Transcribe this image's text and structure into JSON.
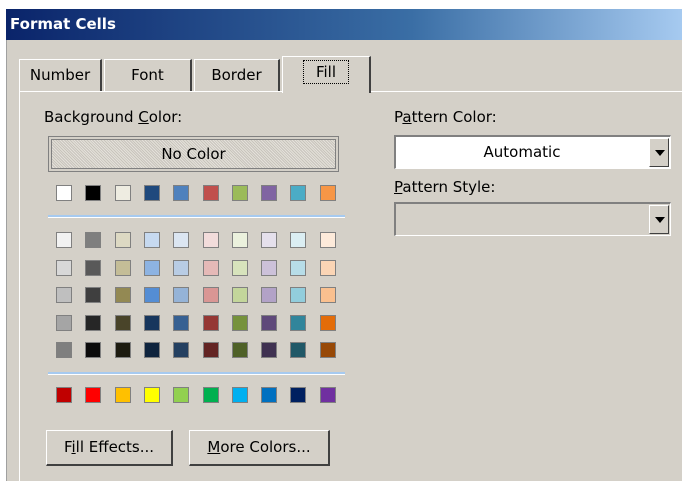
{
  "dialog": {
    "title": "Format Cells"
  },
  "tabs": [
    {
      "label": "Number",
      "active": false
    },
    {
      "label": "Font",
      "active": false
    },
    {
      "label": "Border",
      "active": false
    },
    {
      "label": "Fill",
      "active": true
    }
  ],
  "background": {
    "label_pre": "Background ",
    "label_u": "C",
    "label_post": "olor:",
    "no_color_label": "No Color"
  },
  "palette": {
    "row0": [
      "#ffffff",
      "#000000",
      "#eeece1",
      "#1f497d",
      "#4f81bd",
      "#c0504d",
      "#9bbb59",
      "#8064a2",
      "#4bacc6",
      "#f79646"
    ],
    "tints": [
      [
        "#f2f2f2",
        "#7f7f7f",
        "#ddd9c3",
        "#c6d9f0",
        "#dbe5f1",
        "#f2dcdb",
        "#ebf1dd",
        "#e5e0ec",
        "#dbeef3",
        "#fdeada"
      ],
      [
        "#d8d8d8",
        "#595959",
        "#c4bd97",
        "#8db3e2",
        "#b8cce4",
        "#e5b9b7",
        "#d7e3bc",
        "#ccc1d9",
        "#b7dde8",
        "#fbd5b5"
      ],
      [
        "#bfbfbf",
        "#3f3f3f",
        "#938953",
        "#548dd4",
        "#95b3d7",
        "#d99694",
        "#c3d69b",
        "#b2a2c7",
        "#92cddc",
        "#fac08f"
      ],
      [
        "#a5a5a5",
        "#262626",
        "#494429",
        "#17365d",
        "#366092",
        "#953734",
        "#76923c",
        "#5f497a",
        "#31859b",
        "#e36c09"
      ],
      [
        "#7f7f7f",
        "#0c0c0c",
        "#1d1b10",
        "#0f243e",
        "#244061",
        "#632423",
        "#4f6128",
        "#3f3151",
        "#205867",
        "#974806"
      ]
    ],
    "standard": [
      "#c00000",
      "#ff0000",
      "#ffc000",
      "#ffff00",
      "#92d050",
      "#00b050",
      "#00b0f0",
      "#0070c0",
      "#002060",
      "#7030a0"
    ]
  },
  "buttons": {
    "fill_effects": {
      "pre": "F",
      "u": "i",
      "post": "ll Effects..."
    },
    "more_colors": {
      "pre": "",
      "u": "M",
      "post": "ore Colors..."
    }
  },
  "pattern_color": {
    "label_pre": "P",
    "label_u": "a",
    "label_post": "ttern Color:",
    "value": "Automatic"
  },
  "pattern_style": {
    "label_pre": "",
    "label_u": "P",
    "label_post": "attern Style:",
    "value": ""
  }
}
